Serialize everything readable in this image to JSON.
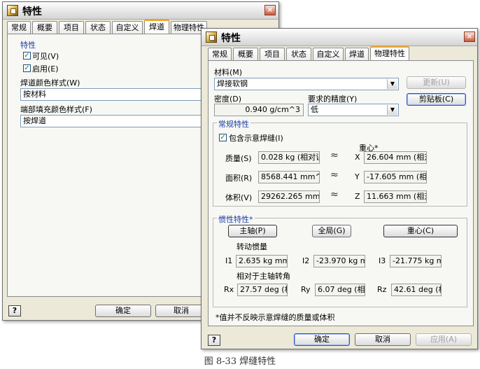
{
  "back_window": {
    "title": "特性",
    "close_glyph": "×",
    "tabs": [
      "常规",
      "概要",
      "项目",
      "状态",
      "自定义",
      "焊道",
      "物理特性"
    ],
    "active_tab": "焊道",
    "group_label": "特性",
    "visible_label": "可见(V)",
    "enable_label": "启用(E)",
    "color_style_label": "焊道颜色样式(W)",
    "color_style_value": "按材料",
    "fill_style_label": "端部填充颜色样式(F)",
    "fill_style_value": "按焊道",
    "help_glyph": "?",
    "ok_label": "确定",
    "cancel_label": "取消"
  },
  "front_window": {
    "title": "特性",
    "close_glyph": "×",
    "tabs": [
      "常规",
      "概要",
      "项目",
      "状态",
      "自定义",
      "焊道",
      "物理特性"
    ],
    "active_tab": "物理特性",
    "material_label": "材料(M)",
    "material_value": "焊接软钢",
    "update_label": "更新(U)",
    "clipboard_label": "剪贴板(C)",
    "density_label": "密度(D)",
    "density_value": "0.940 g/cm^3",
    "accuracy_label": "要求的精度(Y)",
    "accuracy_value": "低",
    "general": {
      "label": "常规特性",
      "include_label": "包含示意焊缝(I)",
      "centroid_label": "重心*",
      "mass_label": "质量(S)",
      "mass_value": "0.028 kg (相对误差",
      "area_label": "面积(R)",
      "area_value": "8568.441 mm^2 (",
      "volume_label": "体积(V)",
      "volume_value": "29262.265 mm^3",
      "approx": "≈",
      "x_label": "X",
      "x_value": "26.604 mm (相对",
      "y_label": "Y",
      "y_value": "-17.605 mm (相对",
      "z_label": "Z",
      "z_value": "11.663 mm (相对"
    },
    "inertia": {
      "label": "惯性特性*",
      "principal_label": "主轴(P)",
      "global_label": "全局(G)",
      "centroid_btn_label": "重心(C)",
      "moments_label": "转动惯量",
      "i1_label": "I1",
      "i1_value": "2.635 kg mm^",
      "i2_label": "I2",
      "i2_value": "-23.970 kg mr",
      "i3_label": "I3",
      "i3_value": "-21.775 kg mr",
      "rotation_label": "相对于主轴转角",
      "rx_label": "Rx",
      "rx_value": "27.57 deg (相",
      "ry_label": "Ry",
      "ry_value": "6.07 deg (相对",
      "rz_label": "Rz",
      "rz_value": "42.61 deg (相"
    },
    "footnote": "*值并不反映示意焊缝的质量或体积",
    "help_glyph": "?",
    "ok_label": "确定",
    "cancel_label": "取消",
    "apply_label": "应用(A)"
  },
  "caption": "图 8-33  焊缝特性"
}
